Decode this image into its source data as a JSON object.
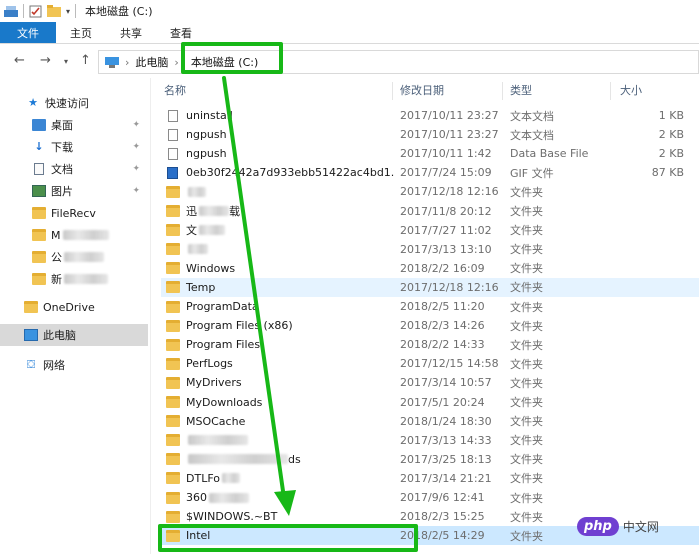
{
  "window": {
    "title": "本地磁盘 (C:)"
  },
  "ribbon": {
    "tabs": [
      "文件",
      "主页",
      "共享",
      "查看"
    ]
  },
  "address": {
    "this_pc": "此电脑",
    "current": "本地磁盘 (C:)"
  },
  "nav": {
    "quick_access": "快速访问",
    "items": [
      {
        "label": "桌面",
        "icon": "desktop-icon",
        "pinned": true
      },
      {
        "label": "下载",
        "icon": "download-icon",
        "pinned": true
      },
      {
        "label": "文档",
        "icon": "document-icon",
        "pinned": true
      },
      {
        "label": "图片",
        "icon": "pictures-icon",
        "pinned": true
      },
      {
        "label": "FileRecv",
        "icon": "folder-icon",
        "pinned": false
      },
      {
        "label": "M",
        "icon": "folder-icon",
        "pinned": false
      },
      {
        "label": "公",
        "icon": "folder-icon",
        "pinned": false
      },
      {
        "label": "新",
        "icon": "folder-icon",
        "pinned": false
      }
    ],
    "onedrive": "OneDrive",
    "this_pc": "此电脑",
    "network": "网络"
  },
  "columns": {
    "name": "名称",
    "date": "修改日期",
    "type": "类型",
    "size": "大小"
  },
  "files": [
    {
      "name": "uninstall",
      "date": "2017/10/11 23:27",
      "type": "文本文档",
      "size": "1 KB",
      "icon": "file"
    },
    {
      "name": "ngpush",
      "date": "2017/10/11 23:27",
      "type": "文本文档",
      "size": "2 KB",
      "icon": "file"
    },
    {
      "name": "ngpush",
      "date": "2017/10/11 1:42",
      "type": "Data Base File",
      "size": "2 KB",
      "icon": "file"
    },
    {
      "name": "0eb30f2442a7d933ebb51422ac4bd1...",
      "date": "2017/7/24 15:09",
      "type": "GIF 文件",
      "size": "87 KB",
      "icon": "gif"
    },
    {
      "name": "",
      "date": "2017/12/18 12:16",
      "type": "文件夹",
      "size": "",
      "icon": "folder",
      "blur": 18
    },
    {
      "name": "迅",
      "date": "2017/11/8 20:12",
      "type": "文件夹",
      "size": "",
      "icon": "folder",
      "blur": 30,
      "suffix": "载"
    },
    {
      "name": "文",
      "date": "2017/7/27 11:02",
      "type": "文件夹",
      "size": "",
      "icon": "folder",
      "blur": 26
    },
    {
      "name": "",
      "date": "2017/3/13 13:10",
      "type": "文件夹",
      "size": "",
      "icon": "folder",
      "blur": 20
    },
    {
      "name": "Windows",
      "date": "2018/2/2 16:09",
      "type": "文件夹",
      "size": "",
      "icon": "folder"
    },
    {
      "name": "Temp",
      "date": "2017/12/18 12:16",
      "type": "文件夹",
      "size": "",
      "icon": "folder"
    },
    {
      "name": "ProgramData",
      "date": "2018/2/5 11:20",
      "type": "文件夹",
      "size": "",
      "icon": "folder"
    },
    {
      "name": "Program Files (x86)",
      "date": "2018/2/3 14:26",
      "type": "文件夹",
      "size": "",
      "icon": "folder"
    },
    {
      "name": "Program Files",
      "date": "2018/2/2 14:33",
      "type": "文件夹",
      "size": "",
      "icon": "folder"
    },
    {
      "name": "PerfLogs",
      "date": "2017/12/15 14:58",
      "type": "文件夹",
      "size": "",
      "icon": "folder"
    },
    {
      "name": "MyDrivers",
      "date": "2017/3/14 10:57",
      "type": "文件夹",
      "size": "",
      "icon": "folder"
    },
    {
      "name": "MyDownloads",
      "date": "2017/5/1 20:24",
      "type": "文件夹",
      "size": "",
      "icon": "folder"
    },
    {
      "name": "MSOCache",
      "date": "2018/1/24 18:30",
      "type": "文件夹",
      "size": "",
      "icon": "folder"
    },
    {
      "name": "",
      "date": "2017/3/13 14:33",
      "type": "文件夹",
      "size": "",
      "icon": "folder",
      "blur": 60
    },
    {
      "name": "",
      "date": "2017/3/25 18:13",
      "type": "文件夹",
      "size": "",
      "icon": "folder",
      "blur": 100,
      "suffix": "ds"
    },
    {
      "name": "DTLFo",
      "date": "2017/3/14 21:21",
      "type": "文件夹",
      "size": "",
      "icon": "folder",
      "blur": 18
    },
    {
      "name": "360",
      "date": "2017/9/6 12:41",
      "type": "文件夹",
      "size": "",
      "icon": "folder",
      "blur": 40
    },
    {
      "name": "$WINDOWS.~BT",
      "date": "2018/2/3 15:25",
      "type": "文件夹",
      "size": "",
      "icon": "folder"
    },
    {
      "name": "Intel",
      "date": "2018/2/5 14:29",
      "type": "文件夹",
      "size": "",
      "icon": "folder"
    }
  ],
  "watermark": {
    "logo": "php",
    "text": "中文网"
  },
  "colors": {
    "accent": "#1979ca",
    "highlight": "#17b817",
    "selection": "#cce8ff"
  }
}
